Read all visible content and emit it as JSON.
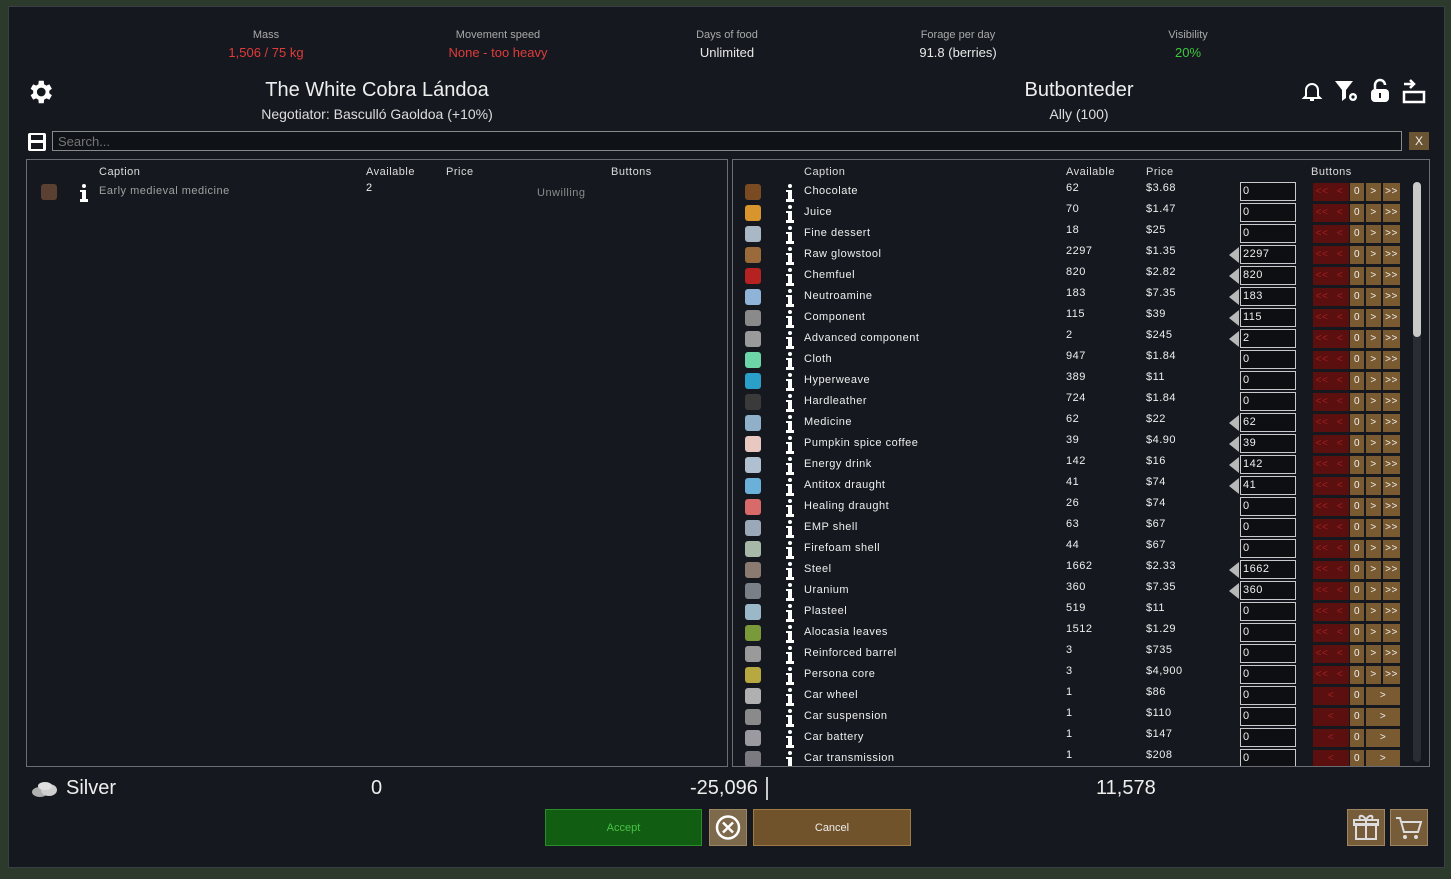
{
  "stats": [
    {
      "label": "Mass",
      "value": "1,506 / 75 kg",
      "color": "red"
    },
    {
      "label": "Movement speed",
      "value": "None - too heavy",
      "color": "red"
    },
    {
      "label": "Days of food",
      "value": "Unlimited",
      "color": "white"
    },
    {
      "label": "Forage per day",
      "value": "91.8 (berries)",
      "color": "white"
    },
    {
      "label": "Visibility",
      "value": "20%",
      "color": "green"
    }
  ],
  "left_faction": {
    "name": "The White Cobra Lándoa",
    "sub": "Negotiator: Basculló Gaoldoa (+10%)"
  },
  "right_faction": {
    "name": "Butbonteder",
    "sub": "Ally (100)"
  },
  "top_icons": [
    "bell-icon",
    "filter-icon",
    "lock-icon",
    "export-icon"
  ],
  "search": {
    "placeholder": "Search...",
    "clear_label": "X"
  },
  "headers": {
    "caption": "Caption",
    "available": "Available",
    "price": "Price",
    "buttons": "Buttons"
  },
  "left_items": [
    {
      "caption": "Early medieval medicine",
      "available": "2",
      "status": "Unwilling"
    }
  ],
  "right_items": [
    {
      "caption": "Chocolate",
      "available": "62",
      "price": "$3.68",
      "qty": "0",
      "icon_color": "#7a4a22"
    },
    {
      "caption": "Juice",
      "available": "70",
      "price": "$1.47",
      "qty": "0",
      "icon_color": "#d9952d"
    },
    {
      "caption": "Fine dessert",
      "available": "18",
      "price": "$25",
      "qty": "0",
      "icon_color": "#a9b8c4"
    },
    {
      "caption": "Raw glowstool",
      "available": "2297",
      "price": "$1.35",
      "qty": "2297",
      "icon_color": "#9a6a3a"
    },
    {
      "caption": "Chemfuel",
      "available": "820",
      "price": "$2.82",
      "qty": "820",
      "icon_color": "#b62222"
    },
    {
      "caption": "Neutroamine",
      "available": "183",
      "price": "$7.35",
      "qty": "183",
      "icon_color": "#8fb4d8"
    },
    {
      "caption": "Component",
      "available": "115",
      "price": "$39",
      "qty": "115",
      "icon_color": "#8a8a8a"
    },
    {
      "caption": "Advanced component",
      "available": "2",
      "price": "$245",
      "qty": "2",
      "icon_color": "#9a9a9a"
    },
    {
      "caption": "Cloth",
      "available": "947",
      "price": "$1.84",
      "qty": "0",
      "icon_color": "#6dd6a8"
    },
    {
      "caption": "Hyperweave",
      "available": "389",
      "price": "$11",
      "qty": "0",
      "icon_color": "#2aa0c8"
    },
    {
      "caption": "Hardleather",
      "available": "724",
      "price": "$1.84",
      "qty": "0",
      "icon_color": "#3a3a3a"
    },
    {
      "caption": "Medicine",
      "available": "62",
      "price": "$22",
      "qty": "62",
      "icon_color": "#8fb0c8"
    },
    {
      "caption": "Pumpkin spice coffee",
      "available": "39",
      "price": "$4.90",
      "qty": "39",
      "icon_color": "#e8c8c0"
    },
    {
      "caption": "Energy drink",
      "available": "142",
      "price": "$16",
      "qty": "142",
      "icon_color": "#b0c0d0"
    },
    {
      "caption": "Antitox draught",
      "available": "41",
      "price": "$74",
      "qty": "41",
      "icon_color": "#6ab0d8"
    },
    {
      "caption": "Healing draught",
      "available": "26",
      "price": "$74",
      "qty": "0",
      "icon_color": "#d86a6a"
    },
    {
      "caption": "EMP shell",
      "available": "63",
      "price": "$67",
      "qty": "0",
      "icon_color": "#9aa8b8"
    },
    {
      "caption": "Firefoam shell",
      "available": "44",
      "price": "$67",
      "qty": "0",
      "icon_color": "#a8b8a8"
    },
    {
      "caption": "Steel",
      "available": "1662",
      "price": "$2.33",
      "qty": "1662",
      "icon_color": "#8a7a70"
    },
    {
      "caption": "Uranium",
      "available": "360",
      "price": "$7.35",
      "qty": "360",
      "icon_color": "#7a8088"
    },
    {
      "caption": "Plasteel",
      "available": "519",
      "price": "$11",
      "qty": "0",
      "icon_color": "#9ab8c8"
    },
    {
      "caption": "Alocasia leaves",
      "available": "1512",
      "price": "$1.29",
      "qty": "0",
      "icon_color": "#7a9a3a"
    },
    {
      "caption": "Reinforced barrel",
      "available": "3",
      "price": "$735",
      "qty": "0",
      "icon_color": "#9a9a9a"
    },
    {
      "caption": "Persona core",
      "available": "3",
      "price": "$4,900",
      "qty": "0",
      "icon_color": "#b8a840"
    },
    {
      "caption": "Car wheel",
      "available": "1",
      "price": "$86",
      "qty": "0",
      "icon_color": "#b0b0b0"
    },
    {
      "caption": "Car suspension",
      "available": "1",
      "price": "$110",
      "qty": "0",
      "icon_color": "#8a8a8a"
    },
    {
      "caption": "Car battery",
      "available": "1",
      "price": "$147",
      "qty": "0",
      "icon_color": "#9a9aa0"
    },
    {
      "caption": "Car transmission",
      "available": "1",
      "price": "$208",
      "qty": "0",
      "icon_color": "#7a7a80"
    }
  ],
  "row_buttons": {
    "far_left": "<<",
    "left": "<",
    "zero": "0",
    "right": ">",
    "far_right": ">>"
  },
  "silver": {
    "label": "Silver",
    "left_value": "0",
    "balance": "-25,096",
    "right_value": "11,578"
  },
  "actions": {
    "accept": "Accept",
    "cancel": "Cancel"
  },
  "colors": {
    "accept_bg": "#115d12",
    "cancel_bg": "#70532b",
    "warning": "#e23b3b",
    "ok": "#3ec63e"
  }
}
